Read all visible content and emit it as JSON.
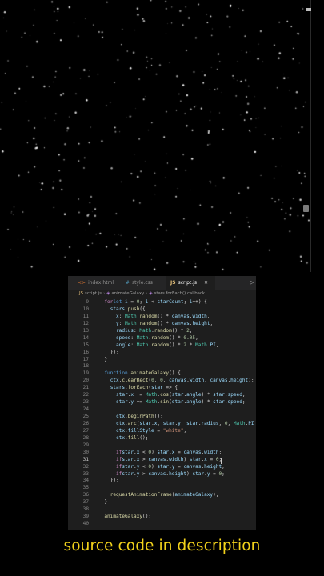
{
  "tabs": [
    {
      "label": "index.html",
      "icon": "<>",
      "active": false
    },
    {
      "label": "style.css",
      "icon": "#",
      "active": false
    },
    {
      "label": "script.js",
      "icon": "JS",
      "active": true
    }
  ],
  "run_icon": "▷",
  "breadcrumb": [
    "script.js",
    "animateGalaxy",
    "stars.forEach() callback"
  ],
  "code_lines": [
    {
      "n": "9",
      "t": "  for (let i = 0; i < starCount; i++) {"
    },
    {
      "n": "10",
      "t": "    stars.push({"
    },
    {
      "n": "11",
      "t": "      x: Math.random() * canvas.width,"
    },
    {
      "n": "12",
      "t": "      y: Math.random() * canvas.height,"
    },
    {
      "n": "13",
      "t": "      radius: Math.random() * 2,"
    },
    {
      "n": "14",
      "t": "      speed: Math.random() * 0.05,"
    },
    {
      "n": "15",
      "t": "      angle: Math.random() * 2 * Math.PI,"
    },
    {
      "n": "16",
      "t": "    });"
    },
    {
      "n": "17",
      "t": "  }"
    },
    {
      "n": "18",
      "t": ""
    },
    {
      "n": "19",
      "t": "  function animateGalaxy() {"
    },
    {
      "n": "20",
      "t": "    ctx.clearRect(0, 0, canvas.width, canvas.height);"
    },
    {
      "n": "21",
      "t": "    stars.forEach(star => {"
    },
    {
      "n": "22",
      "t": "      star.x += Math.cos(star.angle) * star.speed;"
    },
    {
      "n": "23",
      "t": "      star.y += Math.sin(star.angle) * star.speed;"
    },
    {
      "n": "24",
      "t": ""
    },
    {
      "n": "25",
      "t": "      ctx.beginPath();"
    },
    {
      "n": "26",
      "t": "      ctx.arc(star.x, star.y, star.radius, 0, Math.PI *"
    },
    {
      "n": "27",
      "t": "      ctx.fillStyle = \"white\";"
    },
    {
      "n": "28",
      "t": "      ctx.fill();"
    },
    {
      "n": "29",
      "t": ""
    },
    {
      "n": "30",
      "t": "      if (star.x < 0) star.x = canvas.width;"
    },
    {
      "n": "31",
      "t": "      if (star.x > canvas.width) star.x = 0;"
    },
    {
      "n": "32",
      "t": "      if (star.y < 0) star.y = canvas.height;"
    },
    {
      "n": "33",
      "t": "      if (star.y > canvas.height) star.y = 0;"
    },
    {
      "n": "34",
      "t": "    });"
    },
    {
      "n": "35",
      "t": ""
    },
    {
      "n": "36",
      "t": "    requestAnimationFrame(animateGalaxy);"
    },
    {
      "n": "37",
      "t": "  }"
    },
    {
      "n": "38",
      "t": ""
    },
    {
      "n": "39",
      "t": "  animateGalaxy();"
    },
    {
      "n": "40",
      "t": ""
    }
  ],
  "current_line": "31",
  "caption": "source code in description",
  "colors": {
    "background": "#000000",
    "editor_bg": "#1e1e1e",
    "tab_bar_bg": "#252526",
    "caption": "#f2d21b",
    "star": "#ffffff"
  }
}
